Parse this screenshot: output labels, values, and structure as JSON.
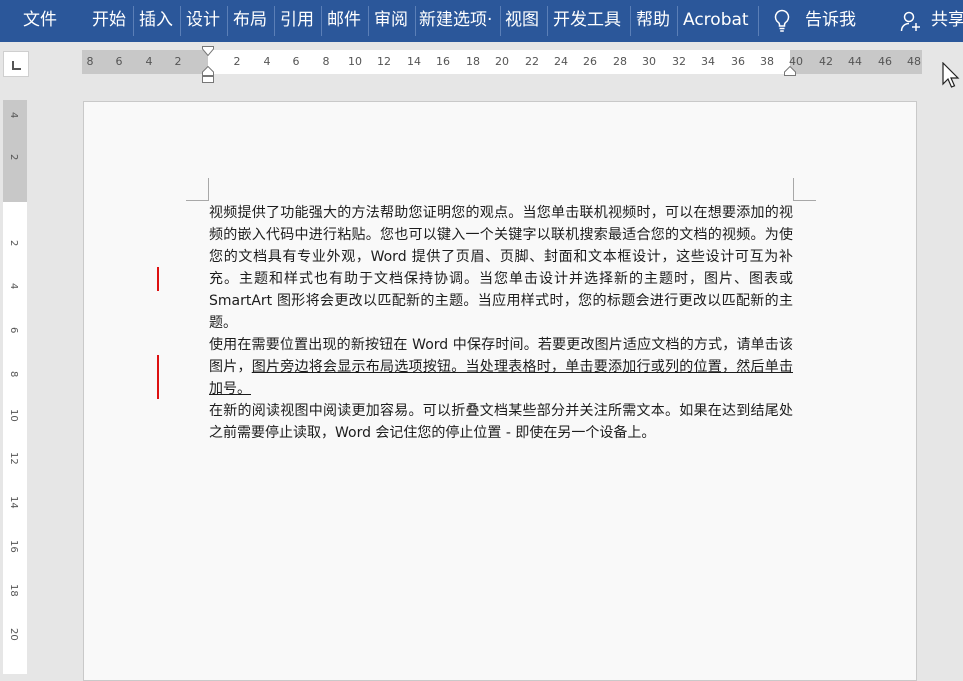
{
  "ribbon": {
    "tabs": [
      "文件",
      "开始",
      "插入",
      "设计",
      "布局",
      "引用",
      "邮件",
      "审阅",
      "新建选项·",
      "视图",
      "开发工具",
      "帮助",
      "Acrobat"
    ],
    "tell_me": "告诉我",
    "share": "共享"
  },
  "ruler": {
    "horizontal": [
      "8",
      "6",
      "4",
      "2",
      "2",
      "4",
      "6",
      "8",
      "10",
      "12",
      "14",
      "16",
      "18",
      "20",
      "22",
      "24",
      "26",
      "28",
      "30",
      "32",
      "34",
      "36",
      "38",
      "40",
      "42",
      "44",
      "46",
      "48"
    ],
    "vertical": [
      "4",
      "2",
      "2",
      "4",
      "6",
      "8",
      "10",
      "12",
      "14",
      "16",
      "18",
      "20"
    ]
  },
  "document": {
    "paragraph1": "视频提供了功能强大的方法帮助您证明您的观点。当您单击联机视频时，可以在想要添加的视频的嵌入代码中进行粘贴。您也可以键入一个关键字以联机搜索最适合您的文档的视频。为使您的文档具有专业外观，Word 提供了页眉、页脚、封面和文本框设计，这些设计可互为补充。主题和样式也有助于文档保持协调。当您单击设计并选择新的主题时，图片、图表或 SmartArt 图形将会更改以匹配新的主题。当应用样式时，您的标题会进行更改以匹配新的主题。",
    "paragraph2_plain": "使用在需要位置出现的新按钮在 Word 中保存时间。若要更改图片适应文档的方式，请单击该图片，",
    "paragraph2_underlined": "图片旁边将会显示布局选项按钮。当处理表格时，单击要添加行或列的位置，然后单击加号。",
    "paragraph3": "在新的阅读视图中阅读更加容易。可以折叠文档某些部分并关注所需文本。如果在达到结尾处之前需要停止读取，Word 会记住您的停止位置 - 即使在另一个设备上。"
  },
  "colors": {
    "ribbon": "#2b579a",
    "change_bar": "#dd1111"
  }
}
